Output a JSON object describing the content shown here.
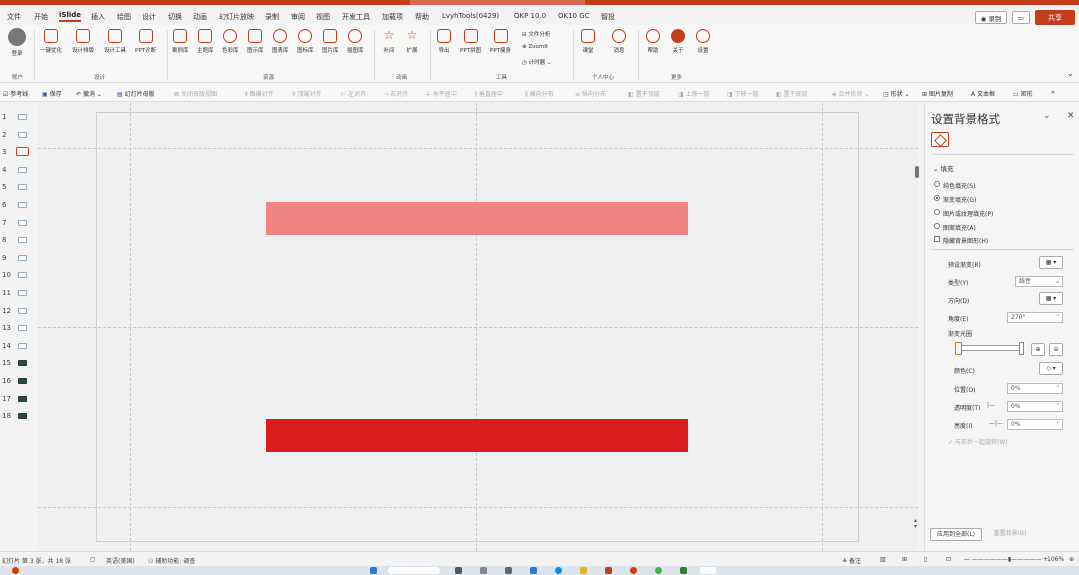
{
  "menubar": {
    "items": [
      "文件",
      "开始",
      "iSlide",
      "插入",
      "绘图",
      "设计",
      "切换",
      "动画",
      "幻灯片放映",
      "录制",
      "审阅",
      "视图",
      "开发工具",
      "加载项",
      "帮助",
      "LvyhTools(0429)",
      "OKP 10.0",
      "OK10 GC",
      "智投"
    ],
    "record_label": "◉ 录制",
    "comment_icon": "comment-icon",
    "share_label": "共享"
  },
  "ribbon": {
    "groups": [
      {
        "name": "账户",
        "items": [
          "登录"
        ]
      },
      {
        "name": "设计",
        "items": [
          "一键优化",
          "设计排版",
          "设计工具",
          "PPT诊断"
        ]
      },
      {
        "name": "资源",
        "items": [
          "案例库",
          "主题库",
          "色彩库",
          "图示库",
          "图表库",
          "图标库",
          "图片库",
          "插图库"
        ]
      },
      {
        "name": "动画",
        "items": [
          "补间",
          "扩展"
        ]
      },
      {
        "name": "工具",
        "items": [
          "导出",
          "PPT拼图",
          "PPT瘦身",
          "文件分析",
          "ZoomIt",
          "计时器"
        ]
      },
      {
        "name": "个人中心",
        "items": [
          "课堂",
          "消息"
        ]
      },
      {
        "name": "更多",
        "items": [
          "帮助",
          "关于",
          "设置"
        ]
      }
    ]
  },
  "toolbar2": {
    "items": [
      "参考线",
      "保存",
      "撤消",
      "幻灯片母版",
      "关闭母版视图",
      "图编对齐",
      "顶端对齐",
      "左对齐",
      "右对齐",
      "水平居中",
      "垂直居中",
      "横向分布",
      "纵向分布",
      "置于顶层",
      "上移一层",
      "下移一层",
      "置于底层",
      "合并形状",
      "形状",
      "图片复制",
      "文本框",
      "矩形"
    ]
  },
  "thumbnails": [
    "1",
    "2",
    "3",
    "4",
    "5",
    "6",
    "7",
    "8",
    "9",
    "10",
    "11",
    "12",
    "13",
    "14",
    "15",
    "16",
    "17",
    "18"
  ],
  "panel": {
    "title": "设置背景格式",
    "section": "填充",
    "fill_options": [
      "纯色填充(S)",
      "渐变填充(G)",
      "图片或纹理填充(P)",
      "图案填充(A)"
    ],
    "hide_graphics": "隐藏背景图形(H)",
    "preset_label": "预设渐变(R)",
    "type_label": "类型(Y)",
    "type_value": "线性",
    "direction_label": "方向(D)",
    "angle_label": "角度(E)",
    "angle_value": "270°",
    "stops_label": "渐变光圈",
    "color_label": "颜色(C)",
    "position_label": "位置(O)",
    "position_value": "0%",
    "transparency_label": "透明度(T)",
    "transparency_value": "0%",
    "brightness_label": "亮度(I)",
    "brightness_value": "0%",
    "rotate_label": "与形状一起旋转(W)",
    "apply_all": "应用到全部(L)",
    "reset": "重置背景(B)"
  },
  "statusbar": {
    "slide_info": "幻灯片 第 3 张，共 18 张",
    "language": "英语(美国)",
    "accessibility": "辅助功能: 调查",
    "notes": "备注",
    "zoom": "106%"
  },
  "colors": {
    "accent": "#c43e1c",
    "bar_light": "#f08482",
    "bar_dark": "#da1d1d"
  }
}
